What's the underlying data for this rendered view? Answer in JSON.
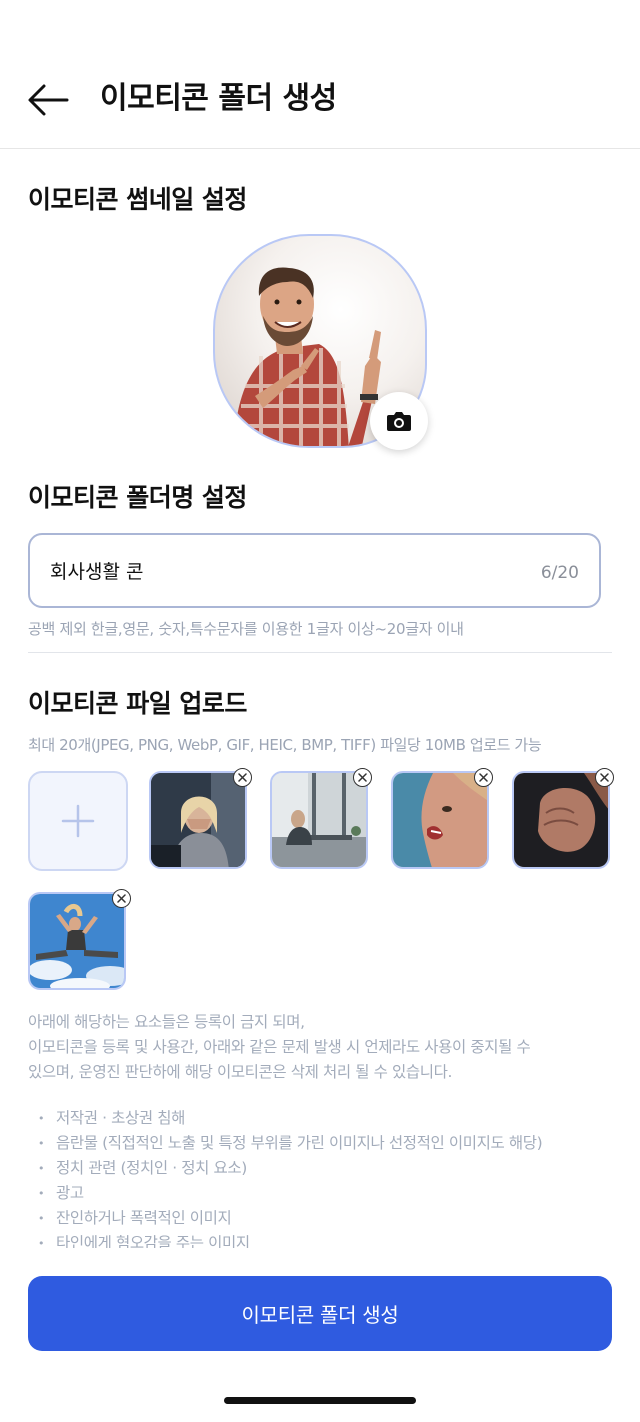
{
  "header": {
    "title": "이모티콘 폴더 생성"
  },
  "thumbnail_section": {
    "title": "이모티콘 썸네일 설정"
  },
  "folder_name_section": {
    "title": "이모티콘 폴더명 설정",
    "value": "회사생활 콘",
    "count": "6/20",
    "hint": "공백 제외 한글,영문, 숫자,특수문자를 이용한 1글자 이상~20글자 이내"
  },
  "upload_section": {
    "title": "이모티콘 파일 업로드",
    "description": "최대 20개(JPEG, PNG, WebP, GIF, HEIC, BMP, TIFF) 파일당 10MB 업로드 가능",
    "notice_lines": [
      "아래에 해당하는 요소들은 등록이 금지 되며,",
      "이모티콘을 등록 및 사용간, 아래와 같은 문제 발생 시 언제라도 사용이 중지될 수",
      "있으며, 운영진 판단하에 해당 이모티콘은 삭제 처리 될 수 있습니다."
    ],
    "rules": [
      "저작권 · 초상권 침해",
      "음란물 (직접적인 노출 및 특정 부위를 가린 이미지나 선정적인 이미지도 해당)",
      "정치 관련 (정치인 · 정치 요소)",
      "광고",
      "잔인하거나 폭력적인 이미지",
      "타인에게 혐오감을 주는 이미지"
    ]
  },
  "submit_button": {
    "label": "이모티콘 폴더 생성"
  },
  "colors": {
    "primary": "#2f5be0",
    "border_accent": "#b9c8f5",
    "muted_text": "#9ba4b4"
  }
}
